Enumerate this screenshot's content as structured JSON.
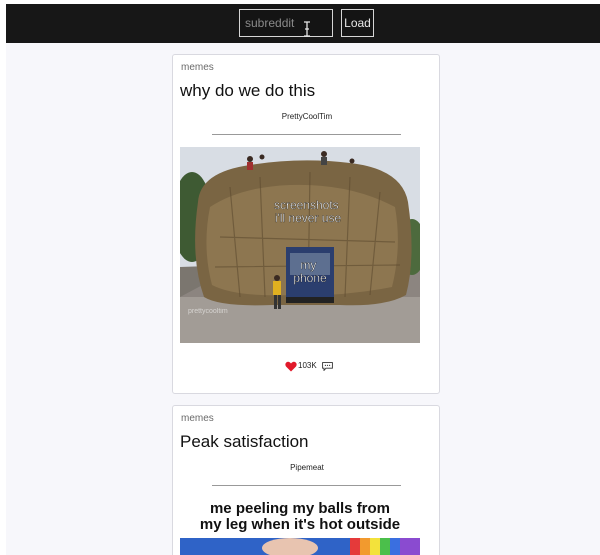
{
  "search": {
    "placeholder": "subreddit"
  },
  "toolbar": {
    "load_label": "Load"
  },
  "icons": {
    "cursor": "text-cursor-icon",
    "heart": "heart-icon",
    "comment": "comment-icon"
  },
  "colors": {
    "topbar": "#171717",
    "background": "#f7f7fb",
    "heart": "#e11a2b"
  },
  "posts": [
    {
      "subreddit": "memes",
      "title": "why do we do this",
      "author": "PrettyCoolTim",
      "image_caption_top": "screenshots\ni'll never use",
      "image_caption_bottom": "my\nphone",
      "image_watermark": "prettycooltim",
      "likes": "103K"
    },
    {
      "subreddit": "memes",
      "title": "Peak satisfaction",
      "author": "Pipemeat",
      "image_caption": "me peeling my balls from\nmy leg when it's hot outside"
    }
  ]
}
